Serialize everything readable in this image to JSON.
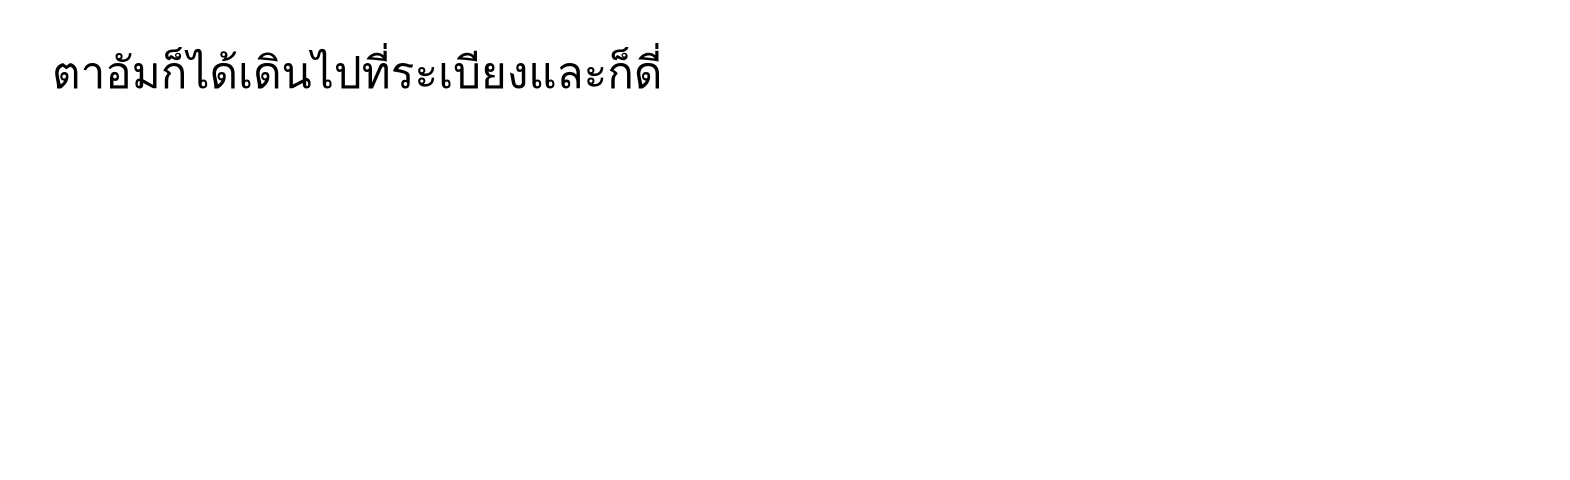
{
  "text": {
    "line": "ตาอัมก็ได้เดินไปที่ระเบียงและก็ดี่"
  }
}
